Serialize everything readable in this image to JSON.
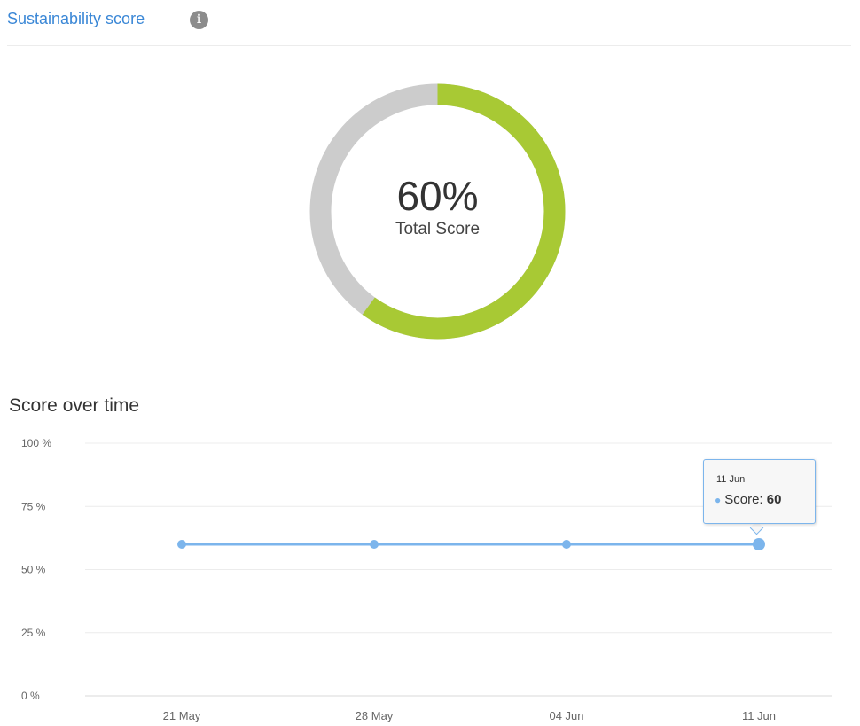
{
  "header": {
    "title": "Sustainability score",
    "info_icon": "info-icon"
  },
  "summary": {
    "score_value": 0.6,
    "score_text": "60%",
    "score_label": "Total Score",
    "colors": {
      "filled": "#a8c934",
      "remaining": "#cccccc"
    }
  },
  "chart_data": {
    "type": "line",
    "title": "Score over time",
    "xlabel": "",
    "ylabel": "",
    "categories": [
      "21 May",
      "28 May",
      "04 Jun",
      "11 Jun"
    ],
    "yticks": [
      "0 %",
      "25 %",
      "50 %",
      "75 %",
      "100 %"
    ],
    "ylim": [
      0,
      100
    ],
    "grid": true,
    "series": [
      {
        "name": "Score",
        "values": [
          60,
          60,
          60,
          60
        ],
        "color": "#7cb5ec"
      }
    ],
    "tooltip": {
      "date": "11 Jun",
      "label": "Score:",
      "value": "60"
    }
  }
}
